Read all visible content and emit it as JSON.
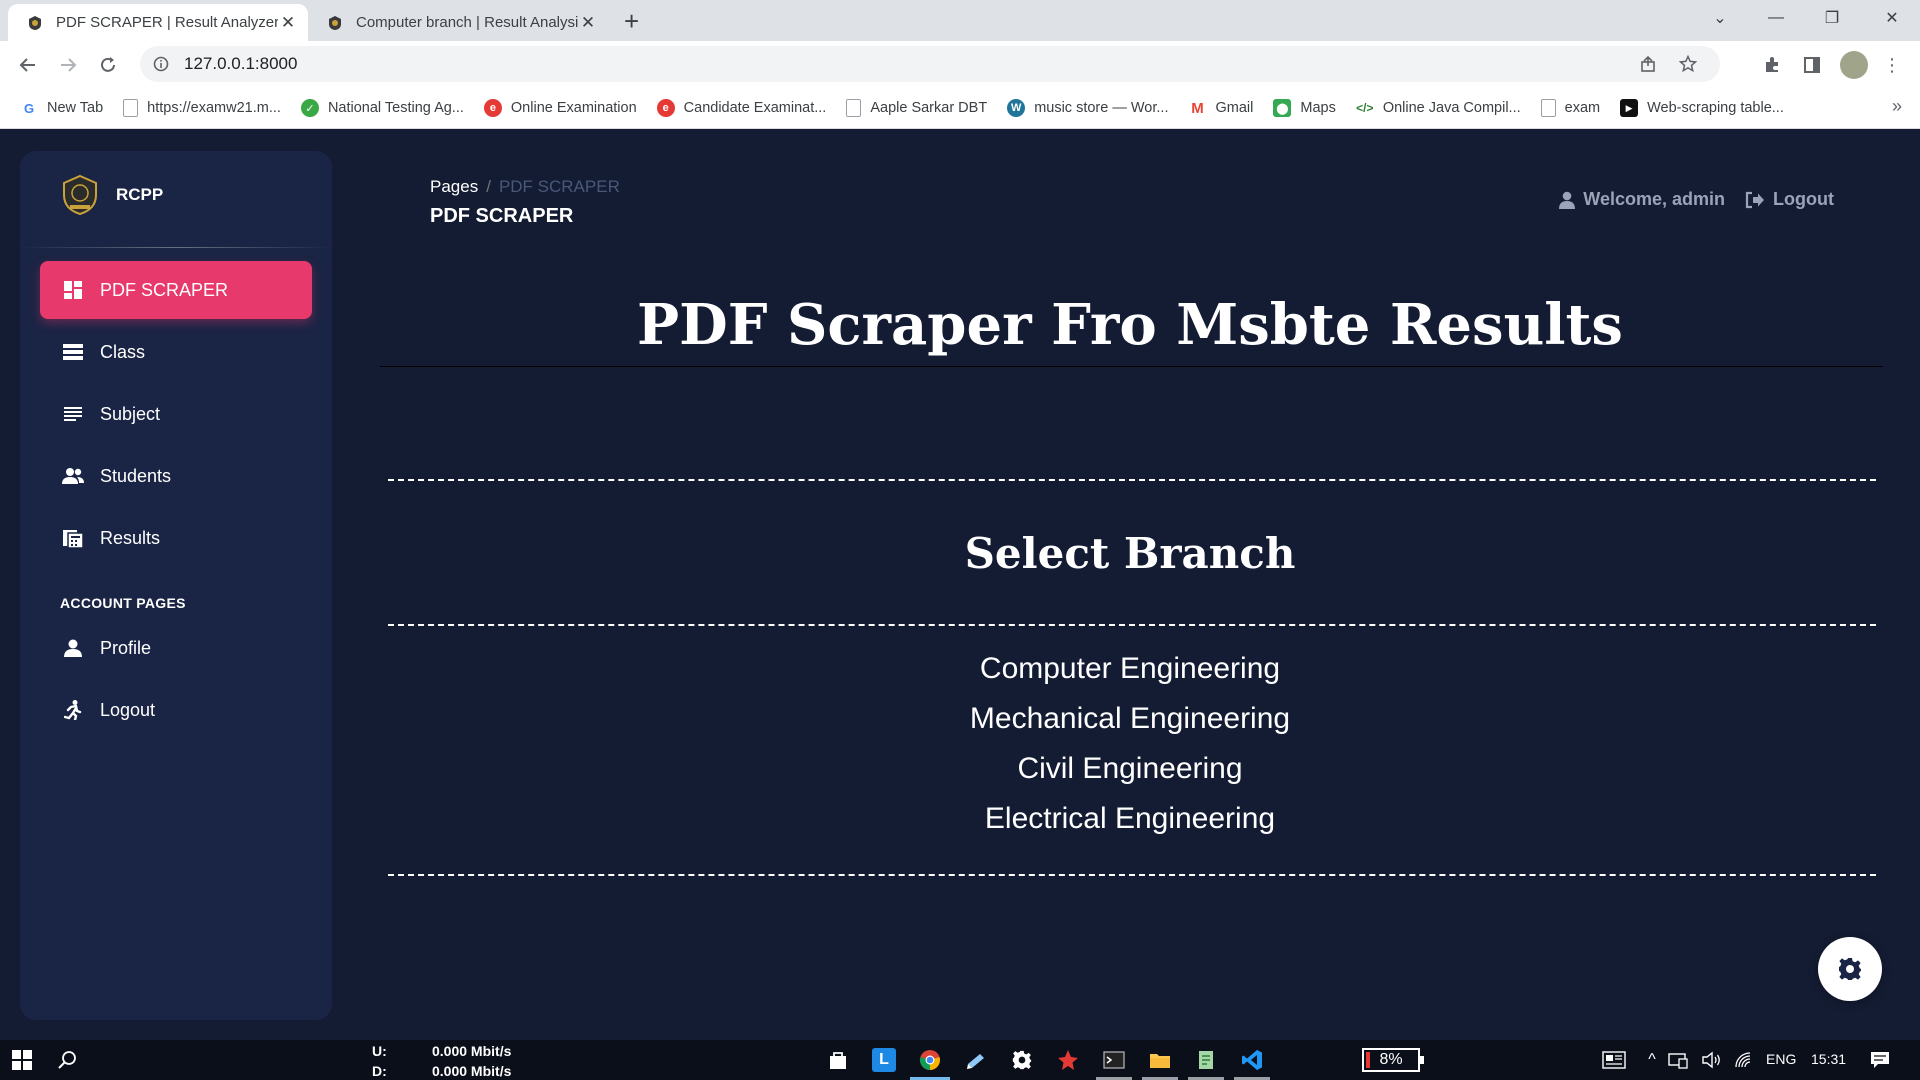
{
  "browser": {
    "tabs": [
      {
        "title": "PDF SCRAPER | Result Analyzer System",
        "active": true
      },
      {
        "title": "Computer branch | Result Analysis",
        "active": false
      }
    ],
    "url": "127.0.0.1:8000",
    "bookmarks": [
      {
        "label": "New Tab",
        "icon": "google-icon"
      },
      {
        "label": "https://examw21.m...",
        "icon": "page-icon"
      },
      {
        "label": "National Testing Ag...",
        "icon": "nta-icon"
      },
      {
        "label": "Online Examination",
        "icon": "exam-icon"
      },
      {
        "label": "Candidate Examinat...",
        "icon": "exam-icon"
      },
      {
        "label": "Aaple Sarkar DBT",
        "icon": "page-icon"
      },
      {
        "label": "music store — Wor...",
        "icon": "wordpress-icon"
      },
      {
        "label": "Gmail",
        "icon": "gmail-icon"
      },
      {
        "label": "Maps",
        "icon": "maps-icon"
      },
      {
        "label": "Online Java Compil...",
        "icon": "code-icon"
      },
      {
        "label": "exam",
        "icon": "page-icon"
      },
      {
        "label": "Web-scraping table...",
        "icon": "video-icon"
      }
    ],
    "more_bookmarks": "»"
  },
  "sidebar": {
    "brand": "RCPP",
    "items": [
      {
        "label": "PDF SCRAPER",
        "icon": "dashboard-icon",
        "active": true
      },
      {
        "label": "Class",
        "icon": "list-icon"
      },
      {
        "label": "Subject",
        "icon": "lines-icon"
      },
      {
        "label": "Students",
        "icon": "users-icon"
      },
      {
        "label": "Results",
        "icon": "calculator-icon"
      }
    ],
    "account_heading": "ACCOUNT PAGES",
    "account_items": [
      {
        "label": "Profile",
        "icon": "user-icon"
      },
      {
        "label": "Logout",
        "icon": "running-icon"
      }
    ]
  },
  "header": {
    "breadcrumb_root": "Pages",
    "breadcrumb_sep": "/",
    "breadcrumb_current": "PDF SCRAPER",
    "page_title": "PDF SCRAPER",
    "welcome": "Welcome, admin",
    "logout": "Logout"
  },
  "main": {
    "headline": "PDF Scraper Fro Msbte Results",
    "section_title": "Select Branch",
    "branches": [
      "Computer Engineering",
      "Mechanical Engineering",
      "Civil Engineering",
      "Electrical Engineering"
    ]
  },
  "taskbar": {
    "net_up_label": "U:",
    "net_up_value": "0.000 Mbit/s",
    "net_down_label": "D:",
    "net_down_value": "0.000 Mbit/s",
    "battery": "8%",
    "battery_level": 0.08,
    "language": "ENG",
    "time": "15:31"
  },
  "colors": {
    "page_bg": "#141c33",
    "sidebar_bg": "#1a2444",
    "accent": "#e8396c"
  }
}
